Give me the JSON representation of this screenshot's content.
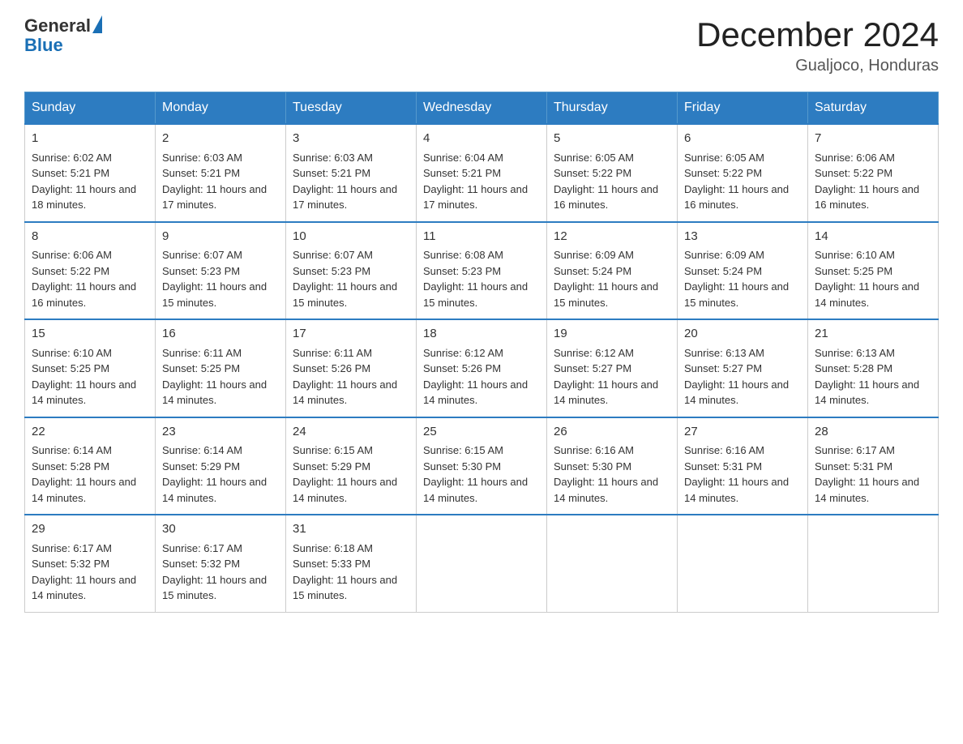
{
  "logo": {
    "text_general": "General",
    "text_blue": "Blue"
  },
  "title": "December 2024",
  "location": "Gualjoco, Honduras",
  "weekdays": [
    "Sunday",
    "Monday",
    "Tuesday",
    "Wednesday",
    "Thursday",
    "Friday",
    "Saturday"
  ],
  "weeks": [
    [
      {
        "day": "1",
        "sunrise": "6:02 AM",
        "sunset": "5:21 PM",
        "daylight": "11 hours and 18 minutes."
      },
      {
        "day": "2",
        "sunrise": "6:03 AM",
        "sunset": "5:21 PM",
        "daylight": "11 hours and 17 minutes."
      },
      {
        "day": "3",
        "sunrise": "6:03 AM",
        "sunset": "5:21 PM",
        "daylight": "11 hours and 17 minutes."
      },
      {
        "day": "4",
        "sunrise": "6:04 AM",
        "sunset": "5:21 PM",
        "daylight": "11 hours and 17 minutes."
      },
      {
        "day": "5",
        "sunrise": "6:05 AM",
        "sunset": "5:22 PM",
        "daylight": "11 hours and 16 minutes."
      },
      {
        "day": "6",
        "sunrise": "6:05 AM",
        "sunset": "5:22 PM",
        "daylight": "11 hours and 16 minutes."
      },
      {
        "day": "7",
        "sunrise": "6:06 AM",
        "sunset": "5:22 PM",
        "daylight": "11 hours and 16 minutes."
      }
    ],
    [
      {
        "day": "8",
        "sunrise": "6:06 AM",
        "sunset": "5:22 PM",
        "daylight": "11 hours and 16 minutes."
      },
      {
        "day": "9",
        "sunrise": "6:07 AM",
        "sunset": "5:23 PM",
        "daylight": "11 hours and 15 minutes."
      },
      {
        "day": "10",
        "sunrise": "6:07 AM",
        "sunset": "5:23 PM",
        "daylight": "11 hours and 15 minutes."
      },
      {
        "day": "11",
        "sunrise": "6:08 AM",
        "sunset": "5:23 PM",
        "daylight": "11 hours and 15 minutes."
      },
      {
        "day": "12",
        "sunrise": "6:09 AM",
        "sunset": "5:24 PM",
        "daylight": "11 hours and 15 minutes."
      },
      {
        "day": "13",
        "sunrise": "6:09 AM",
        "sunset": "5:24 PM",
        "daylight": "11 hours and 15 minutes."
      },
      {
        "day": "14",
        "sunrise": "6:10 AM",
        "sunset": "5:25 PM",
        "daylight": "11 hours and 14 minutes."
      }
    ],
    [
      {
        "day": "15",
        "sunrise": "6:10 AM",
        "sunset": "5:25 PM",
        "daylight": "11 hours and 14 minutes."
      },
      {
        "day": "16",
        "sunrise": "6:11 AM",
        "sunset": "5:25 PM",
        "daylight": "11 hours and 14 minutes."
      },
      {
        "day": "17",
        "sunrise": "6:11 AM",
        "sunset": "5:26 PM",
        "daylight": "11 hours and 14 minutes."
      },
      {
        "day": "18",
        "sunrise": "6:12 AM",
        "sunset": "5:26 PM",
        "daylight": "11 hours and 14 minutes."
      },
      {
        "day": "19",
        "sunrise": "6:12 AM",
        "sunset": "5:27 PM",
        "daylight": "11 hours and 14 minutes."
      },
      {
        "day": "20",
        "sunrise": "6:13 AM",
        "sunset": "5:27 PM",
        "daylight": "11 hours and 14 minutes."
      },
      {
        "day": "21",
        "sunrise": "6:13 AM",
        "sunset": "5:28 PM",
        "daylight": "11 hours and 14 minutes."
      }
    ],
    [
      {
        "day": "22",
        "sunrise": "6:14 AM",
        "sunset": "5:28 PM",
        "daylight": "11 hours and 14 minutes."
      },
      {
        "day": "23",
        "sunrise": "6:14 AM",
        "sunset": "5:29 PM",
        "daylight": "11 hours and 14 minutes."
      },
      {
        "day": "24",
        "sunrise": "6:15 AM",
        "sunset": "5:29 PM",
        "daylight": "11 hours and 14 minutes."
      },
      {
        "day": "25",
        "sunrise": "6:15 AM",
        "sunset": "5:30 PM",
        "daylight": "11 hours and 14 minutes."
      },
      {
        "day": "26",
        "sunrise": "6:16 AM",
        "sunset": "5:30 PM",
        "daylight": "11 hours and 14 minutes."
      },
      {
        "day": "27",
        "sunrise": "6:16 AM",
        "sunset": "5:31 PM",
        "daylight": "11 hours and 14 minutes."
      },
      {
        "day": "28",
        "sunrise": "6:17 AM",
        "sunset": "5:31 PM",
        "daylight": "11 hours and 14 minutes."
      }
    ],
    [
      {
        "day": "29",
        "sunrise": "6:17 AM",
        "sunset": "5:32 PM",
        "daylight": "11 hours and 14 minutes."
      },
      {
        "day": "30",
        "sunrise": "6:17 AM",
        "sunset": "5:32 PM",
        "daylight": "11 hours and 15 minutes."
      },
      {
        "day": "31",
        "sunrise": "6:18 AM",
        "sunset": "5:33 PM",
        "daylight": "11 hours and 15 minutes."
      },
      null,
      null,
      null,
      null
    ]
  ]
}
